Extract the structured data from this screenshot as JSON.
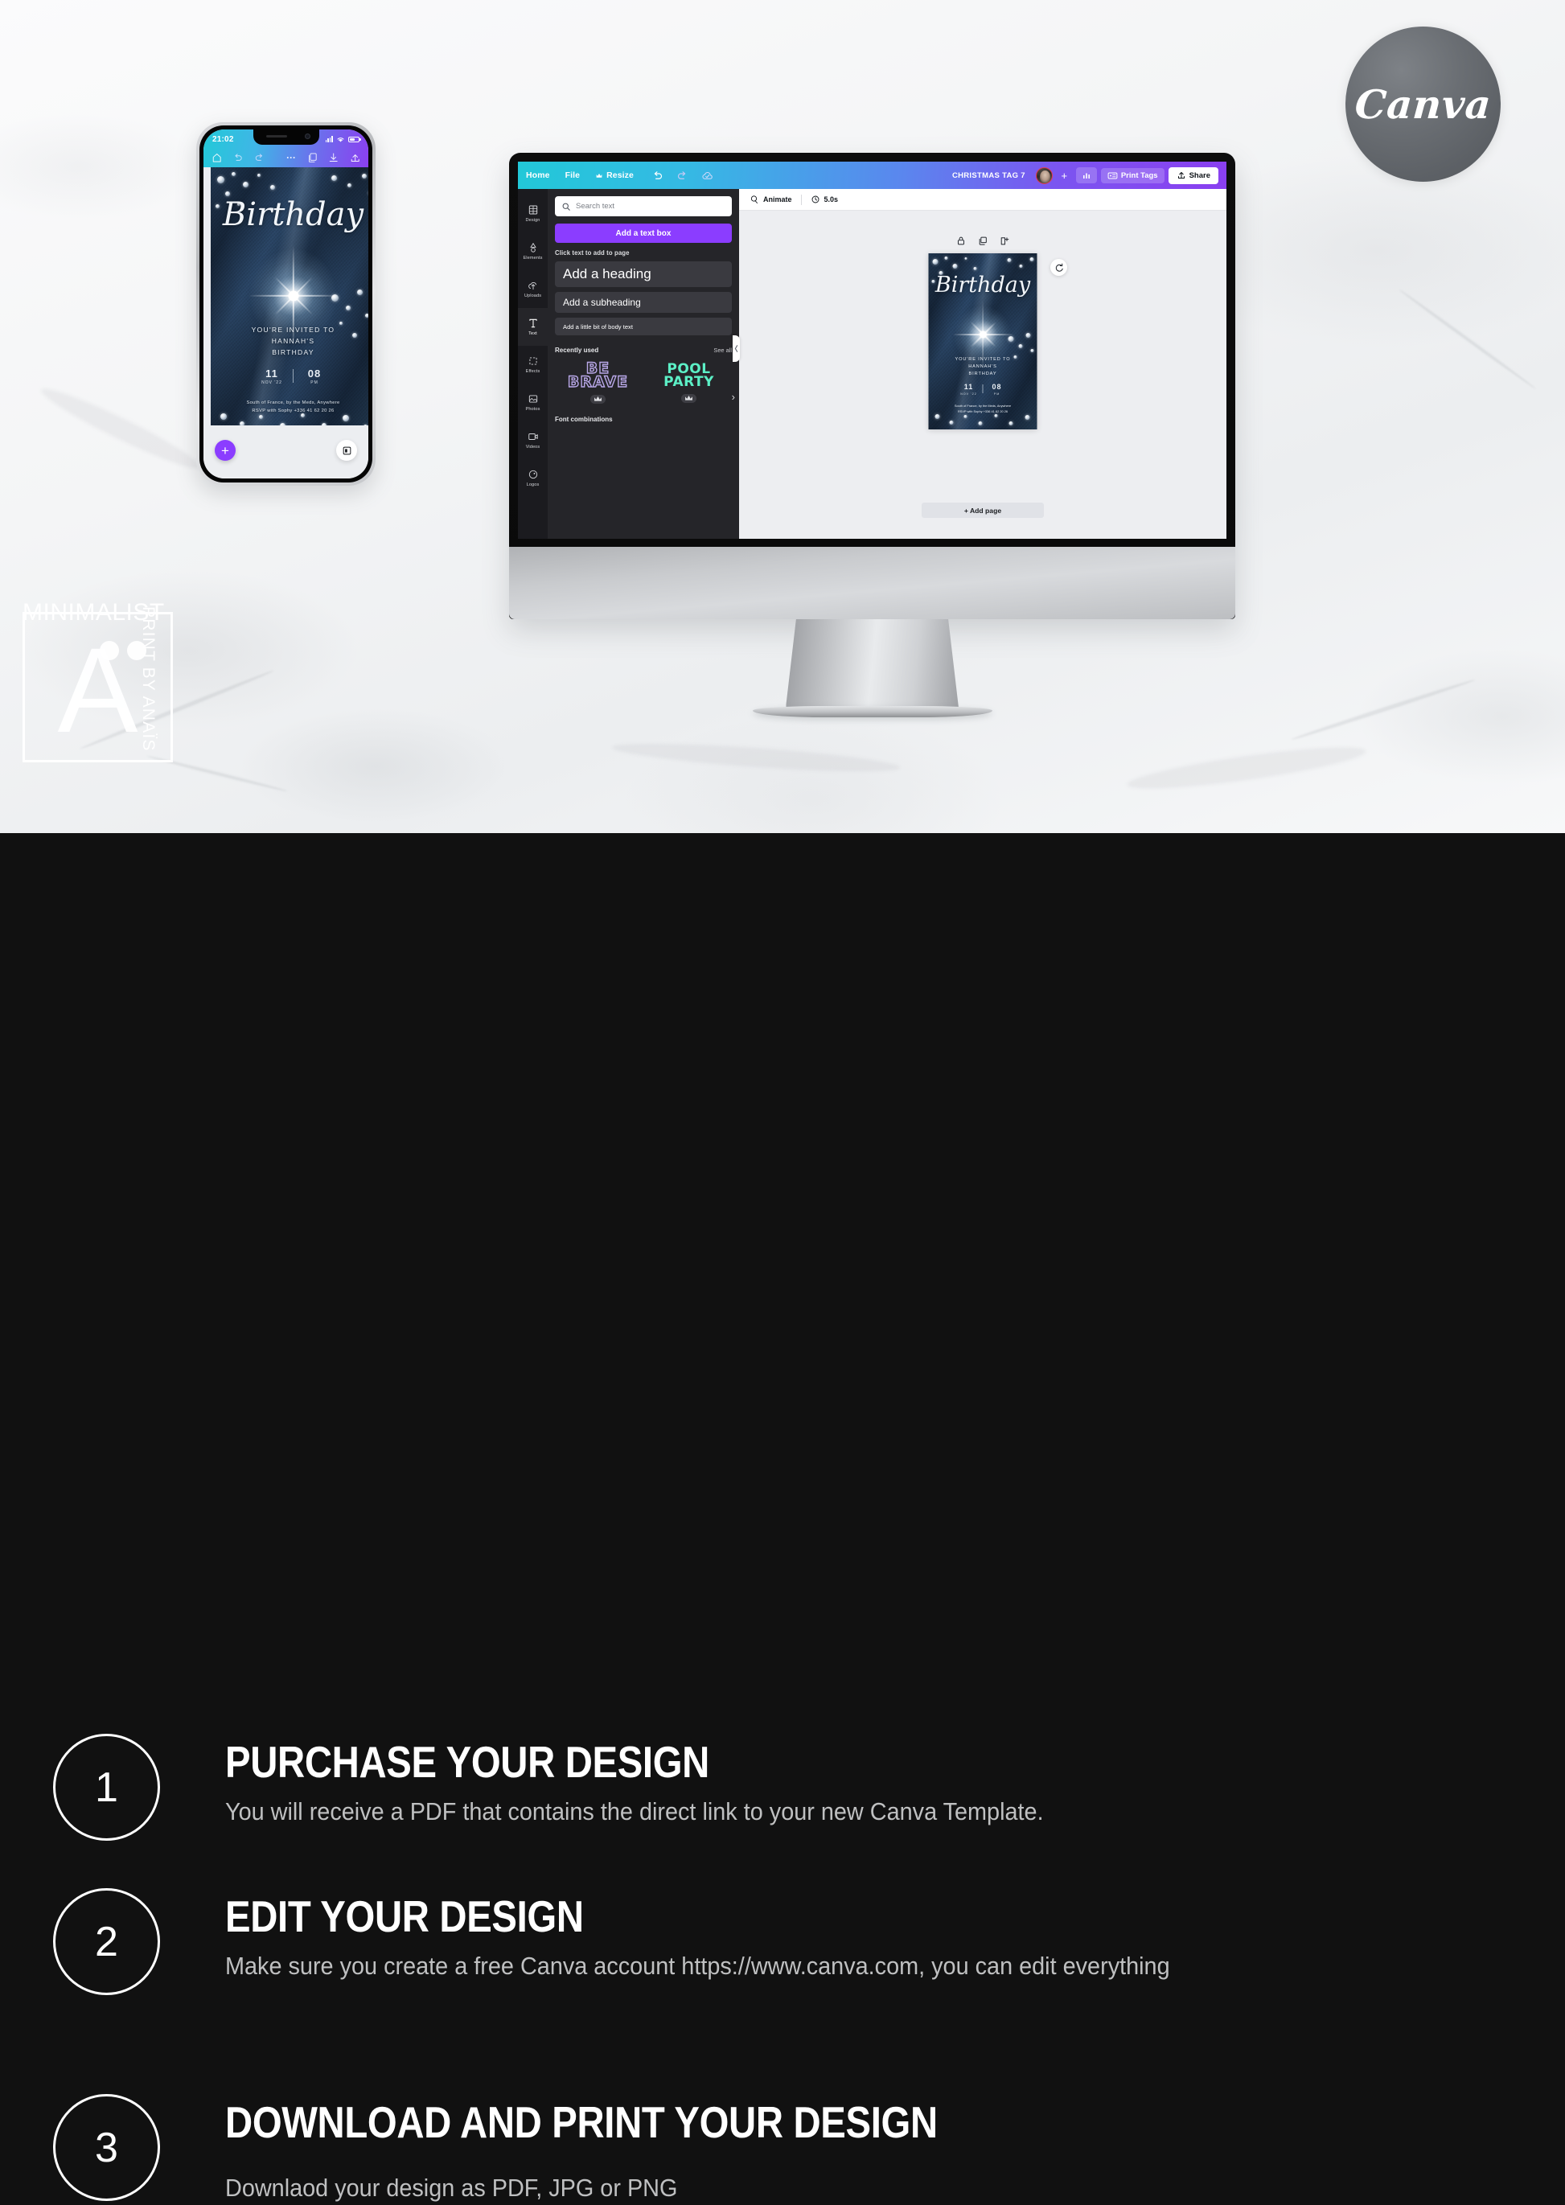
{
  "brand": {
    "canva_logo_text": "Canva",
    "watermark_main": "MINIMALIST",
    "watermark_rotated": "PRINT BY ANAÏS",
    "watermark_letter": "A"
  },
  "colors": {
    "marble_bg": "#f4f5f6",
    "dark_section": "#111111",
    "canva_purple": "#8b3dff",
    "canva_gradient_start": "#22c8d8",
    "canva_gradient_end": "#8a3ff0",
    "mint_accent": "#5cf0c6",
    "lavender_accent": "#b9a8e8",
    "avatar_ring": "#e8394f"
  },
  "phone": {
    "status_time": "21:02",
    "toolbar_icons": [
      "home-icon",
      "undo-icon",
      "redo-icon",
      "more-icon",
      "layers-icon",
      "download-icon",
      "share-icon"
    ],
    "fab_label": "+",
    "pages_icon": "pages-icon"
  },
  "invitation": {
    "script_title": "Birthday",
    "invited_line1": "YOU'RE INVITED TO",
    "invited_line2": "HANNAH'S",
    "invited_line3": "BIRTHDAY",
    "day_number": "11",
    "day_sub": "NOV '22",
    "hour_number": "08",
    "hour_sub": "PM",
    "address": "South of France, by the Meds, Anywhere",
    "rsvp": "RSVP with Sophy +336 41 62 20 26"
  },
  "editor": {
    "menu": [
      {
        "label": "Home",
        "icon": ""
      },
      {
        "label": "File",
        "icon": ""
      },
      {
        "label": "Resize",
        "icon": "crown-icon"
      }
    ],
    "toolbar_icons": [
      "undo-icon",
      "redo-icon",
      "cloud-saved-icon"
    ],
    "design_title": "CHRISTMAS TAG 7",
    "add_collaborator": "+",
    "stats_icon": "bar-chart-icon",
    "print_tags_label": "Print Tags",
    "share_label": "Share",
    "rail": [
      {
        "label": "Design",
        "icon": "templates-icon"
      },
      {
        "label": "Elements",
        "icon": "shapes-icon"
      },
      {
        "label": "Uploads",
        "icon": "uploads-icon"
      },
      {
        "label": "Text",
        "icon": "text-icon"
      },
      {
        "label": "Effects",
        "icon": "effects-icon"
      },
      {
        "label": "Photos",
        "icon": "photos-icon"
      },
      {
        "label": "Videos",
        "icon": "videos-icon"
      },
      {
        "label": "Logos",
        "icon": "logos-icon"
      }
    ],
    "panel": {
      "search_placeholder": "Search text",
      "add_text_box": "Add a text box",
      "hint": "Click text to add to page",
      "options": [
        "Add a heading",
        "Add a subheading",
        "Add a little bit of body text"
      ],
      "recently_used_title": "Recently used",
      "see_all": "See all",
      "recent_items": [
        {
          "line1": "BE",
          "line2": "BRAVE",
          "badge": "crown-icon"
        },
        {
          "line1": "POOL",
          "line2": "PARTY",
          "badge": "crown-icon"
        }
      ],
      "font_combinations": "Font combinations"
    },
    "canvas": {
      "animate_label": "Animate",
      "duration_label": "5.0s",
      "page_tools": [
        "lock-icon",
        "duplicate-icon",
        "add-page-icon"
      ],
      "rotate_icon": "rotate-icon",
      "add_page_label": "+ Add page"
    }
  },
  "steps": [
    {
      "number": "1",
      "title": "PURCHASE YOUR DESIGN",
      "desc": "You will receive a PDF that contains the direct link to your new Canva Template."
    },
    {
      "number": "2",
      "title": "EDIT YOUR DESIGN",
      "desc": "Make sure you create a free Canva account https://www.canva.com, you can edit everything"
    },
    {
      "number": "3",
      "title": "DOWNLOAD AND PRINT  YOUR DESIGN",
      "desc": "Downlaod your design as PDF, JPG or PNG"
    }
  ]
}
